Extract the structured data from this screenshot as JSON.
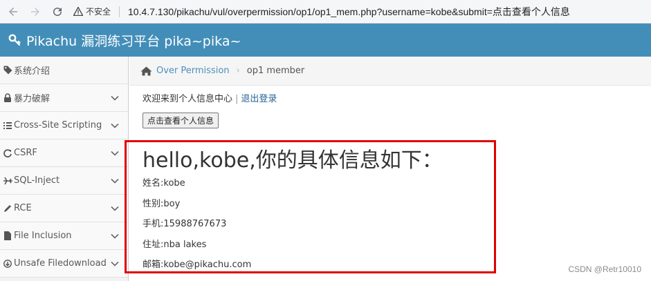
{
  "browser": {
    "security_label": "不安全",
    "url": "10.4.7.130/pikachu/vul/overpermission/op1/op1_mem.php?username=kobe&submit=点击查看个人信息"
  },
  "app": {
    "title": "Pikachu 漏洞练习平台 pika~pika~",
    "header_color": "#438eb9"
  },
  "sidebar": {
    "items": [
      {
        "label": "系统介绍",
        "icon": "tag-icon"
      },
      {
        "label": "暴力破解",
        "icon": "lock-icon"
      },
      {
        "label": "Cross-Site Scripting",
        "icon": "list-icon"
      },
      {
        "label": "CSRF",
        "icon": "refresh-icon"
      },
      {
        "label": "SQL-Inject",
        "icon": "plane-icon"
      },
      {
        "label": "RCE",
        "icon": "pencil-icon"
      },
      {
        "label": "File Inclusion",
        "icon": "file-icon"
      },
      {
        "label": "Unsafe Filedownload",
        "icon": "download-icon"
      }
    ]
  },
  "breadcrumb": {
    "parent": "Over Permission",
    "current": "op1 member"
  },
  "main": {
    "welcome_text": "欢迎来到个人信息中心",
    "separator": "|",
    "logout": "退出登录",
    "view_button": "点击查看个人信息",
    "hello": "hello,kobe,你的具体信息如下：",
    "info": {
      "name": "姓名:kobe",
      "gender": "性别:boy",
      "phone": "手机:15988767673",
      "address": "住址:nba lakes",
      "email": "邮箱:kobe@pikachu.com"
    }
  },
  "watermark": "CSDN @Retr10010",
  "colors": {
    "highlight_border": "#e00000",
    "link": "#4c8fbd"
  }
}
